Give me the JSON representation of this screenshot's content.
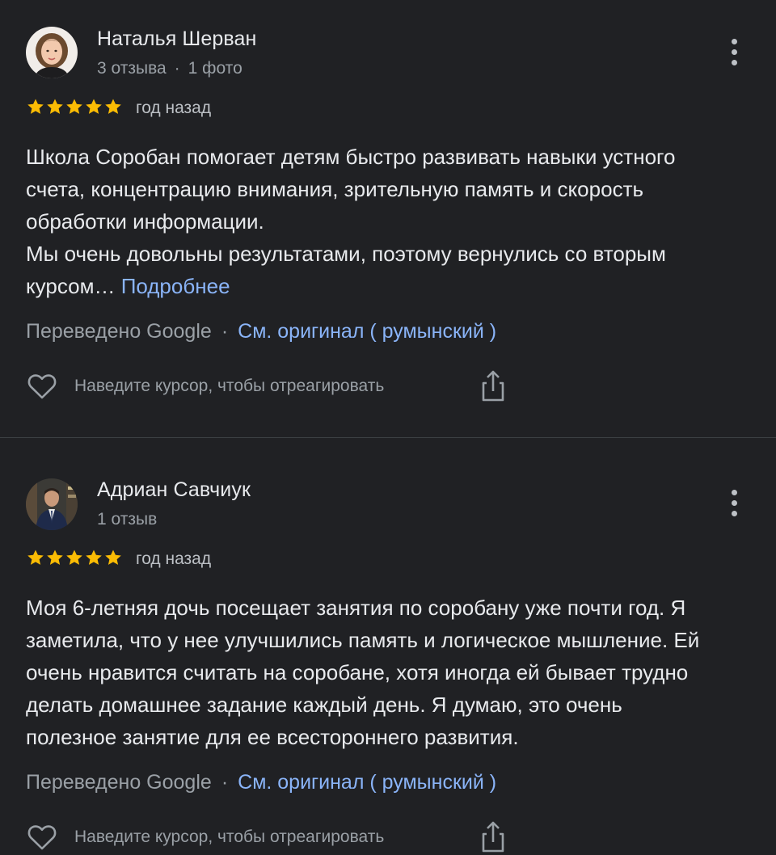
{
  "reviews": [
    {
      "author_name": "Наталья Шерван",
      "review_count": "3 отзыва",
      "photo_count": "1 фото",
      "rating": 5,
      "date": "год назад",
      "text": "Школа Соробан помогает детям быстро развивать навыки устного\nсчета, концентрацию внимания, зрительную память и скорость\nобработки информации.\nМы очень довольны результатами, поэтому вернулись со вторым\nкурсом… ",
      "more_label": "Подробнее",
      "translated_by": "Переведено Google",
      "see_original": "См. оригинал ( румынский )",
      "react_label": "Наведите курсор, чтобы отреагировать"
    },
    {
      "author_name": "Адриан Савчиук",
      "review_count": "1 отзыв",
      "rating": 5,
      "date": "год назад",
      "text": "Моя 6-летняя дочь посещает занятия по соробану уже почти год. Я\nзаметила, что у нее улучшились память и логическое мышление. Ей\nочень нравится считать на соробане, хотя иногда ей бывает трудно\nделать домашнее задание каждый день. Я думаю, это очень\nполезное занятие для ее всестороннего развития.",
      "translated_by": "Переведено Google",
      "see_original": "См. оригинал ( румынский )",
      "react_label": "Наведите курсор, чтобы отреагировать"
    }
  ],
  "separator": "·",
  "icons": {
    "star": "star-icon",
    "heart": "heart-icon",
    "share": "share-icon",
    "more": "more-vert-icon"
  },
  "colors": {
    "background": "#202124",
    "star": "#fbbc04",
    "link": "#8ab4f8",
    "secondary_text": "#9aa0a6"
  }
}
